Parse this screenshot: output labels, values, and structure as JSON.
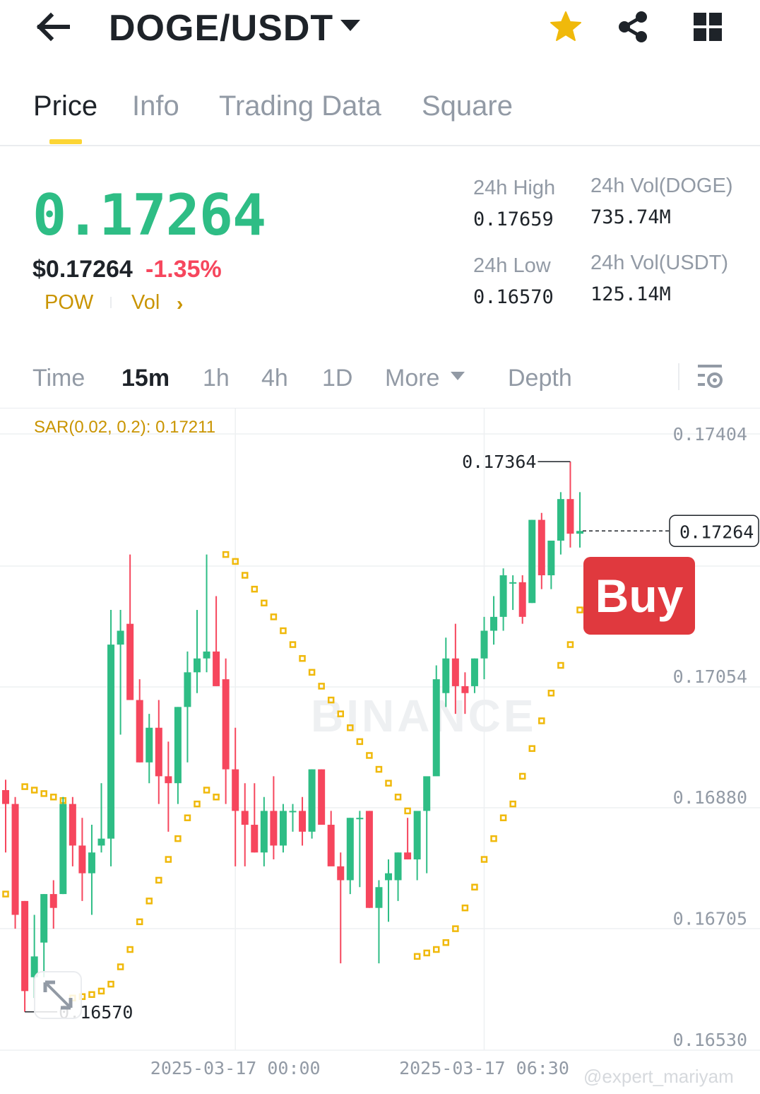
{
  "header": {
    "pair": "DOGE/USDT",
    "icons": [
      "back-arrow-icon",
      "chevron-down-icon",
      "star-icon",
      "share-icon",
      "grid-icon"
    ],
    "star_color": "#f0b90b"
  },
  "tabs": [
    {
      "label": "Price",
      "active": true
    },
    {
      "label": "Info",
      "active": false
    },
    {
      "label": "Trading Data",
      "active": false
    },
    {
      "label": "Square",
      "active": false
    }
  ],
  "price": {
    "last": "0.17264",
    "usd": "$0.17264",
    "change_pct": "-1.35%",
    "tags": [
      "POW",
      "Vol"
    ],
    "up_color": "#2ebd85",
    "down_color": "#f6465d"
  },
  "stats": {
    "high_label": "24h High",
    "high_value": "0.17659",
    "low_label": "24h Low",
    "low_value": "0.16570",
    "vol_base_label": "24h Vol(DOGE)",
    "vol_base_value": "735.74M",
    "vol_quote_label": "24h Vol(USDT)",
    "vol_quote_value": "125.14M"
  },
  "intervals": {
    "items": [
      "Time",
      "15m",
      "1h",
      "4h",
      "1D"
    ],
    "active": "15m",
    "more_label": "More",
    "depth_label": "Depth"
  },
  "chart": {
    "indicator_label": "SAR(0.02, 0.2): 0.17211",
    "buy_label": "Buy",
    "watermark": "BINANCE",
    "credit": "@expert_mariyam",
    "current_price_label": "0.17264",
    "max_label": "0.17364",
    "min_label": "0.16570"
  },
  "chart_data": {
    "type": "candlestick",
    "indicator": "Parabolic SAR (0.02, 0.2)",
    "y_ticks": [
      0.17404,
      0.17054,
      0.1688,
      0.16705,
      0.1653
    ],
    "y_tick_labels": [
      "0.17404",
      "0.17054",
      "0.16880",
      "0.16705",
      "0.16530"
    ],
    "x_labels": [
      "2025-03-17 00:00",
      "2025-03-17 06:30"
    ],
    "x_label_index": [
      24,
      50
    ],
    "ylim": [
      0.165,
      0.1745
    ],
    "current_price": 0.17264,
    "annotated_high": 0.17364,
    "annotated_low": 0.1657,
    "grid": true,
    "candles": [
      {
        "o": 0.1689,
        "h": 0.16905,
        "l": 0.168,
        "c": 0.1687
      },
      {
        "o": 0.1687,
        "h": 0.1688,
        "l": 0.1669,
        "c": 0.1671
      },
      {
        "o": 0.1673,
        "h": 0.1673,
        "l": 0.1657,
        "c": 0.166
      },
      {
        "o": 0.1662,
        "h": 0.1671,
        "l": 0.1659,
        "c": 0.1665
      },
      {
        "o": 0.1667,
        "h": 0.1674,
        "l": 0.1662,
        "c": 0.1674
      },
      {
        "o": 0.1674,
        "h": 0.1676,
        "l": 0.1669,
        "c": 0.1672
      },
      {
        "o": 0.1674,
        "h": 0.1688,
        "l": 0.1674,
        "c": 0.1687
      },
      {
        "o": 0.1687,
        "h": 0.1688,
        "l": 0.1678,
        "c": 0.1681
      },
      {
        "o": 0.1681,
        "h": 0.1685,
        "l": 0.1673,
        "c": 0.1677
      },
      {
        "o": 0.1677,
        "h": 0.1684,
        "l": 0.1671,
        "c": 0.168
      },
      {
        "o": 0.1681,
        "h": 0.169,
        "l": 0.168,
        "c": 0.1682
      },
      {
        "o": 0.1682,
        "h": 0.1715,
        "l": 0.1678,
        "c": 0.171
      },
      {
        "o": 0.171,
        "h": 0.1715,
        "l": 0.1697,
        "c": 0.1712
      },
      {
        "o": 0.1713,
        "h": 0.1723,
        "l": 0.1702,
        "c": 0.1702
      },
      {
        "o": 0.1702,
        "h": 0.1705,
        "l": 0.1693,
        "c": 0.1693
      },
      {
        "o": 0.1693,
        "h": 0.17,
        "l": 0.169,
        "c": 0.1698
      },
      {
        "o": 0.1698,
        "h": 0.1702,
        "l": 0.1687,
        "c": 0.1691
      },
      {
        "o": 0.1691,
        "h": 0.1696,
        "l": 0.1683,
        "c": 0.169
      },
      {
        "o": 0.169,
        "h": 0.1701,
        "l": 0.1687,
        "c": 0.1701
      },
      {
        "o": 0.1701,
        "h": 0.1709,
        "l": 0.1693,
        "c": 0.1706
      },
      {
        "o": 0.1706,
        "h": 0.1715,
        "l": 0.1703,
        "c": 0.1708
      },
      {
        "o": 0.1708,
        "h": 0.1723,
        "l": 0.1706,
        "c": 0.1709
      },
      {
        "o": 0.1709,
        "h": 0.1717,
        "l": 0.1704,
        "c": 0.1704
      },
      {
        "o": 0.1705,
        "h": 0.1708,
        "l": 0.1687,
        "c": 0.1692
      },
      {
        "o": 0.1692,
        "h": 0.1698,
        "l": 0.1678,
        "c": 0.1686
      },
      {
        "o": 0.1686,
        "h": 0.169,
        "l": 0.1678,
        "c": 0.1684
      },
      {
        "o": 0.1684,
        "h": 0.169,
        "l": 0.168,
        "c": 0.168
      },
      {
        "o": 0.168,
        "h": 0.1688,
        "l": 0.1678,
        "c": 0.1686
      },
      {
        "o": 0.1686,
        "h": 0.1691,
        "l": 0.1679,
        "c": 0.1681
      },
      {
        "o": 0.1681,
        "h": 0.1687,
        "l": 0.168,
        "c": 0.1686
      },
      {
        "o": 0.1686,
        "h": 0.1687,
        "l": 0.1683,
        "c": 0.1686
      },
      {
        "o": 0.1686,
        "h": 0.1688,
        "l": 0.1681,
        "c": 0.1683
      },
      {
        "o": 0.1683,
        "h": 0.1692,
        "l": 0.1682,
        "c": 0.1692
      },
      {
        "o": 0.1692,
        "h": 0.1692,
        "l": 0.1684,
        "c": 0.1684
      },
      {
        "o": 0.1684,
        "h": 0.1686,
        "l": 0.1679,
        "c": 0.1678
      },
      {
        "o": 0.1678,
        "h": 0.168,
        "l": 0.1664,
        "c": 0.1676
      },
      {
        "o": 0.1676,
        "h": 0.1685,
        "l": 0.1674,
        "c": 0.1685
      },
      {
        "o": 0.1685,
        "h": 0.1686,
        "l": 0.1675,
        "c": 0.1685
      },
      {
        "o": 0.1686,
        "h": 0.1686,
        "l": 0.1672,
        "c": 0.1672
      },
      {
        "o": 0.1672,
        "h": 0.1676,
        "l": 0.1664,
        "c": 0.1675
      },
      {
        "o": 0.1676,
        "h": 0.1679,
        "l": 0.167,
        "c": 0.1677
      },
      {
        "o": 0.1676,
        "h": 0.168,
        "l": 0.1673,
        "c": 0.168
      },
      {
        "o": 0.168,
        "h": 0.1685,
        "l": 0.1679,
        "c": 0.1679
      },
      {
        "o": 0.1679,
        "h": 0.1685,
        "l": 0.1676,
        "c": 0.1686
      },
      {
        "o": 0.1686,
        "h": 0.169,
        "l": 0.1677,
        "c": 0.1691
      },
      {
        "o": 0.1691,
        "h": 0.1707,
        "l": 0.1692,
        "c": 0.1705
      },
      {
        "o": 0.1703,
        "h": 0.1711,
        "l": 0.1701,
        "c": 0.1708
      },
      {
        "o": 0.1708,
        "h": 0.1713,
        "l": 0.17,
        "c": 0.1704
      },
      {
        "o": 0.1704,
        "h": 0.1706,
        "l": 0.17,
        "c": 0.1703
      },
      {
        "o": 0.1704,
        "h": 0.1708,
        "l": 0.1703,
        "c": 0.1708
      },
      {
        "o": 0.1708,
        "h": 0.1714,
        "l": 0.1705,
        "c": 0.1712
      },
      {
        "o": 0.1712,
        "h": 0.1717,
        "l": 0.171,
        "c": 0.1714
      },
      {
        "o": 0.1714,
        "h": 0.1721,
        "l": 0.1712,
        "c": 0.172
      },
      {
        "o": 0.1719,
        "h": 0.172,
        "l": 0.1715,
        "c": 0.1719
      },
      {
        "o": 0.1719,
        "h": 0.172,
        "l": 0.1713,
        "c": 0.1714
      },
      {
        "o": 0.1716,
        "h": 0.1728,
        "l": 0.1716,
        "c": 0.1728
      },
      {
        "o": 0.1728,
        "h": 0.1729,
        "l": 0.1718,
        "c": 0.172
      },
      {
        "o": 0.172,
        "h": 0.1725,
        "l": 0.1718,
        "c": 0.1725
      },
      {
        "o": 0.1725,
        "h": 0.1732,
        "l": 0.1723,
        "c": 0.1731
      },
      {
        "o": 0.1731,
        "h": 0.17364,
        "l": 0.1724,
        "c": 0.1726
      },
      {
        "o": 0.1726,
        "h": 0.1732,
        "l": 0.1724,
        "c": 0.17264
      }
    ],
    "sar": [
      {
        "i": 0,
        "v": 0.1674
      },
      {
        "i": 2,
        "v": 0.16895
      },
      {
        "i": 3,
        "v": 0.1689
      },
      {
        "i": 4,
        "v": 0.16885
      },
      {
        "i": 5,
        "v": 0.1688
      },
      {
        "i": 6,
        "v": 0.16875
      },
      {
        "i": 7,
        "v": 0.1659
      },
      {
        "i": 8,
        "v": 0.16592
      },
      {
        "i": 9,
        "v": 0.16595
      },
      {
        "i": 10,
        "v": 0.166
      },
      {
        "i": 11,
        "v": 0.1661
      },
      {
        "i": 12,
        "v": 0.16635
      },
      {
        "i": 13,
        "v": 0.1666
      },
      {
        "i": 14,
        "v": 0.167
      },
      {
        "i": 15,
        "v": 0.1673
      },
      {
        "i": 16,
        "v": 0.1676
      },
      {
        "i": 17,
        "v": 0.1679
      },
      {
        "i": 18,
        "v": 0.1682
      },
      {
        "i": 19,
        "v": 0.1685
      },
      {
        "i": 20,
        "v": 0.1687
      },
      {
        "i": 21,
        "v": 0.1689
      },
      {
        "i": 22,
        "v": 0.1688
      },
      {
        "i": 23,
        "v": 0.1723
      },
      {
        "i": 24,
        "v": 0.1722
      },
      {
        "i": 25,
        "v": 0.172
      },
      {
        "i": 26,
        "v": 0.1718
      },
      {
        "i": 27,
        "v": 0.1716
      },
      {
        "i": 28,
        "v": 0.1714
      },
      {
        "i": 29,
        "v": 0.1712
      },
      {
        "i": 30,
        "v": 0.171
      },
      {
        "i": 31,
        "v": 0.1708
      },
      {
        "i": 32,
        "v": 0.1706
      },
      {
        "i": 33,
        "v": 0.1704
      },
      {
        "i": 34,
        "v": 0.1702
      },
      {
        "i": 35,
        "v": 0.17
      },
      {
        "i": 36,
        "v": 0.1698
      },
      {
        "i": 37,
        "v": 0.1696
      },
      {
        "i": 38,
        "v": 0.1694
      },
      {
        "i": 39,
        "v": 0.1692
      },
      {
        "i": 40,
        "v": 0.169
      },
      {
        "i": 41,
        "v": 0.1688
      },
      {
        "i": 42,
        "v": 0.1686
      },
      {
        "i": 43,
        "v": 0.1665
      },
      {
        "i": 44,
        "v": 0.16655
      },
      {
        "i": 45,
        "v": 0.1666
      },
      {
        "i": 46,
        "v": 0.1667
      },
      {
        "i": 47,
        "v": 0.1669
      },
      {
        "i": 48,
        "v": 0.1672
      },
      {
        "i": 49,
        "v": 0.1675
      },
      {
        "i": 50,
        "v": 0.1679
      },
      {
        "i": 51,
        "v": 0.1682
      },
      {
        "i": 52,
        "v": 0.1685
      },
      {
        "i": 53,
        "v": 0.1687
      },
      {
        "i": 54,
        "v": 0.1691
      },
      {
        "i": 55,
        "v": 0.1695
      },
      {
        "i": 56,
        "v": 0.1699
      },
      {
        "i": 57,
        "v": 0.1703
      },
      {
        "i": 58,
        "v": 0.1707
      },
      {
        "i": 59,
        "v": 0.171
      },
      {
        "i": 60,
        "v": 0.1715
      }
    ]
  }
}
